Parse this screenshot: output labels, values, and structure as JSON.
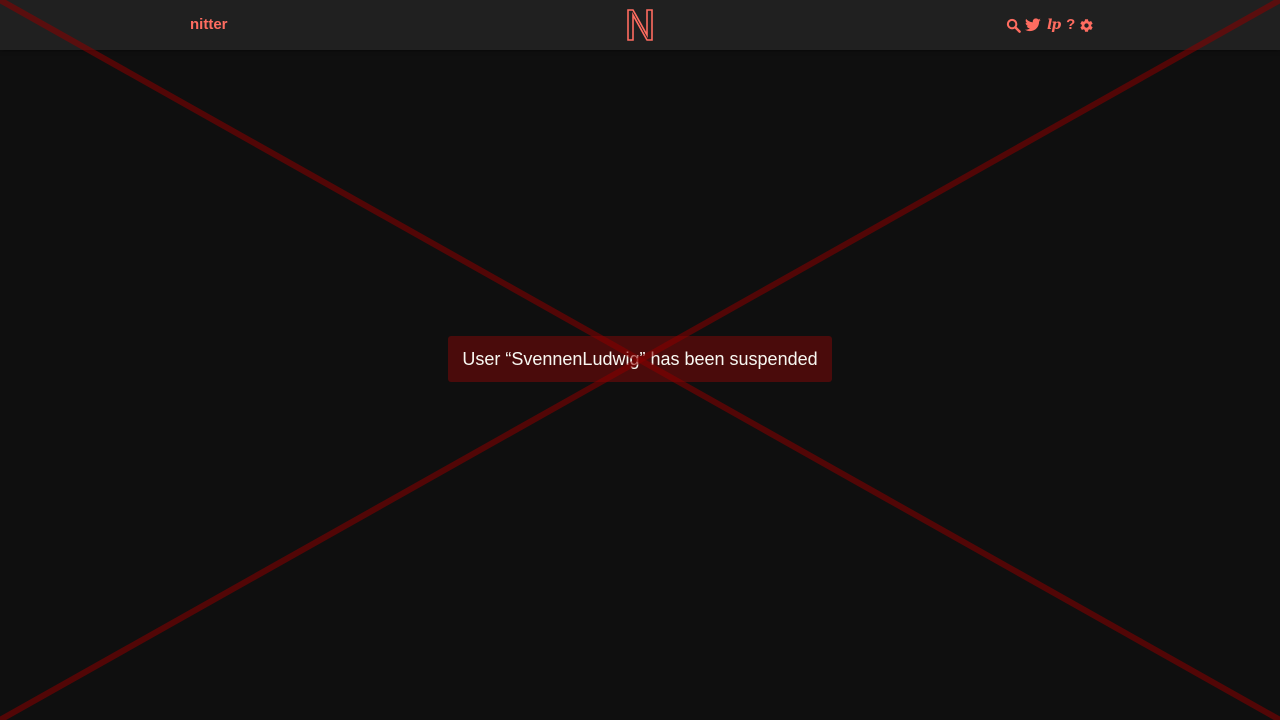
{
  "header": {
    "brand": "nitter",
    "logo_letter": "N",
    "icons": {
      "search": "search-icon",
      "twitter": "twitter-bird-icon",
      "instance": "lp",
      "about": "?",
      "settings": "gear-icon"
    }
  },
  "error": {
    "message": "User “SvennenLudwig” has been suspended"
  },
  "colors": {
    "accent": "#ff6c60",
    "background": "#0f0f0f",
    "navbar": "#202020",
    "error_bg": "#4a0b0b",
    "cross": "#8b0000"
  }
}
